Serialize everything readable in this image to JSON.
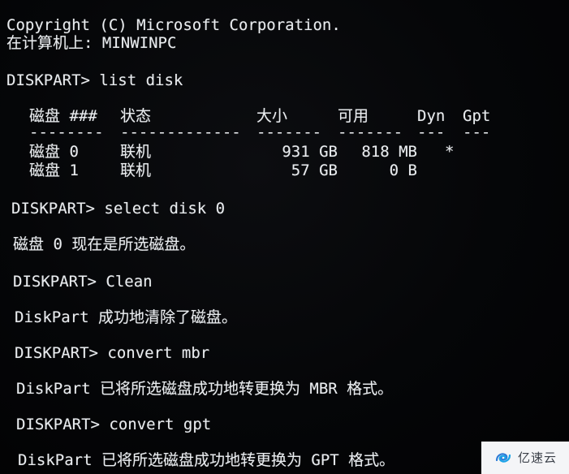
{
  "header": {
    "copyright": "Copyright (C) Microsoft Corporation.",
    "computer": "在计算机上: MINWINPC"
  },
  "session": {
    "cmd_list_disk": "DISKPART> list disk",
    "cmd_select_disk": "DISKPART> select disk 0",
    "msg_select_disk": "磁盘 0 现在是所选磁盘。",
    "cmd_clean": "DISKPART> Clean",
    "msg_clean": "DiskPart 成功地清除了磁盘。",
    "cmd_convert_mbr": "DISKPART> convert mbr",
    "msg_convert_mbr": "DiskPart 已将所选磁盘成功地转更换为 MBR 格式。",
    "cmd_convert_gpt": "DISKPART> convert gpt",
    "msg_convert_gpt": "DiskPart 已将所选磁盘成功地转更换为 GPT 格式。"
  },
  "disk_table": {
    "headers": {
      "disk": "磁盘 ###",
      "status": "状态",
      "size": "大小",
      "free": "可用",
      "dyn": "Dyn",
      "gpt": "Gpt"
    },
    "separators": {
      "disk": "--------",
      "status": "-------------",
      "size": "-------",
      "free": "-------",
      "dyn": "---",
      "gpt": "---"
    },
    "rows": [
      {
        "disk": "磁盘 0",
        "status": "联机",
        "size": "931 GB",
        "free": "818 MB",
        "dyn": "",
        "gpt": "*"
      },
      {
        "disk": "磁盘 1",
        "status": "联机",
        "size": "57 GB",
        "free": "0 B",
        "dyn": "",
        "gpt": ""
      }
    ]
  },
  "watermark": {
    "icon": "yisu-cloud-logo-icon",
    "text": "亿速云"
  }
}
